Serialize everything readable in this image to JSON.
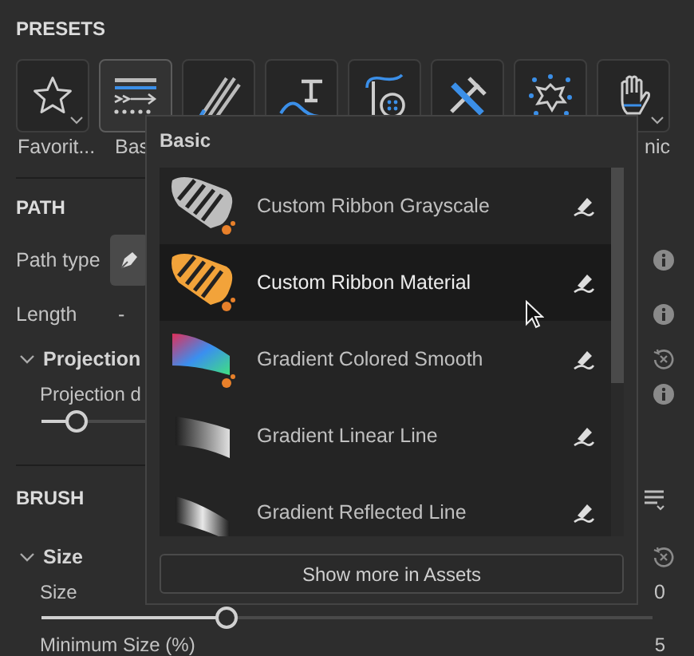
{
  "presets": {
    "title": "PRESETS",
    "tiles": [
      {
        "kind": "star",
        "label": "Favorit...",
        "selected": false,
        "dropdown": true
      },
      {
        "kind": "lines",
        "label": "Bas",
        "selected": true,
        "dropdown": false
      },
      {
        "kind": "pencils",
        "selected": false,
        "dropdown": false
      },
      {
        "kind": "hammer-curve",
        "selected": false,
        "dropdown": false
      },
      {
        "kind": "needle",
        "selected": false,
        "dropdown": false
      },
      {
        "kind": "tools",
        "selected": false,
        "dropdown": false
      },
      {
        "kind": "burst",
        "selected": false,
        "dropdown": false
      },
      {
        "kind": "hand",
        "label": "nic",
        "selected": false,
        "dropdown": true
      }
    ]
  },
  "path": {
    "title": "PATH",
    "path_type": {
      "label": "Path type"
    },
    "length": {
      "label": "Length",
      "value": "-"
    },
    "projection": {
      "title": "Projection",
      "expanded": true,
      "field_label": "Projection d",
      "slider": {
        "level": 0.06
      }
    }
  },
  "brush": {
    "title": "BRUSH",
    "size": {
      "title": "Size",
      "expanded": true,
      "field_label": "Size",
      "value": "0",
      "slider": {
        "level": 0.3
      }
    },
    "min_size": {
      "label": "Minimum Size (%)",
      "value": "5"
    }
  },
  "popup": {
    "title": "Basic",
    "items": [
      {
        "kind": "ribbon-gray",
        "name": "Custom Ribbon Grayscale",
        "highlighted": false
      },
      {
        "kind": "ribbon-orange",
        "name": "Custom Ribbon Material",
        "highlighted": true
      },
      {
        "kind": "gradient-color",
        "name": "Gradient Colored Smooth",
        "highlighted": false
      },
      {
        "kind": "gradient-linear",
        "name": "Gradient Linear Line",
        "highlighted": false
      },
      {
        "kind": "gradient-reflected",
        "name": "Gradient Reflected Line",
        "highlighted": false
      }
    ],
    "button": "Show more in Assets"
  }
}
